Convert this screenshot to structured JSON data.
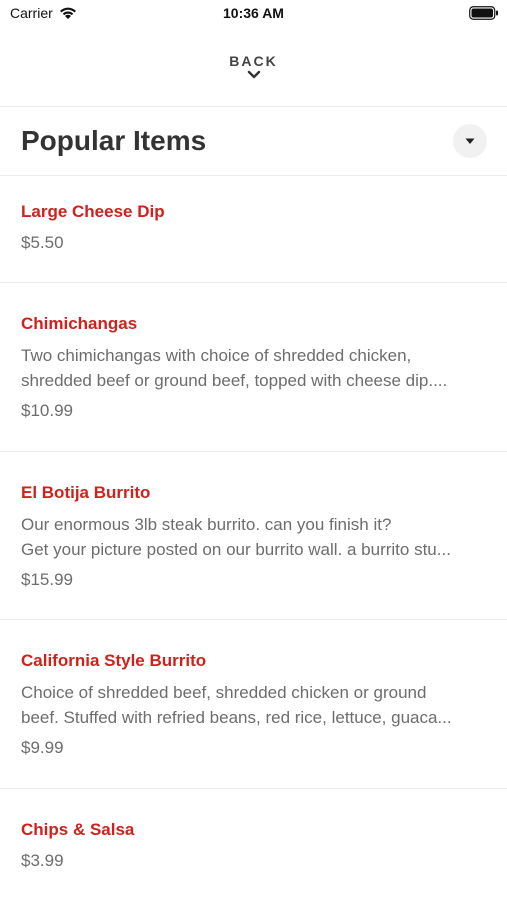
{
  "status_bar": {
    "carrier": "Carrier",
    "time": "10:36 AM"
  },
  "nav": {
    "back_label": "BACK"
  },
  "header": {
    "title": "Popular Items"
  },
  "colors": {
    "item_name": "#d0211c",
    "text_secondary": "#6d6d6d",
    "divider": "#ececec"
  },
  "items": [
    {
      "name": "Large Cheese Dip",
      "description_lines": [],
      "price": "$5.50"
    },
    {
      "name": "Chimichangas",
      "description_lines": [
        "Two chimichangas with choice of shredded chicken,",
        "shredded beef or ground beef, topped with cheese dip...."
      ],
      "price": "$10.99"
    },
    {
      "name": "El Botija Burrito",
      "description_lines": [
        "Our enormous 3lb steak burrito. can you finish it?",
        "Get your picture posted on our burrito wall. a burrito stu..."
      ],
      "price": "$15.99"
    },
    {
      "name": "California Style Burrito",
      "description_lines": [
        "Choice of shredded beef, shredded chicken or ground",
        "beef. Stuffed with refried beans, red rice, lettuce, guaca..."
      ],
      "price": "$9.99"
    },
    {
      "name": "Chips & Salsa",
      "description_lines": [],
      "price": "$3.99"
    }
  ]
}
